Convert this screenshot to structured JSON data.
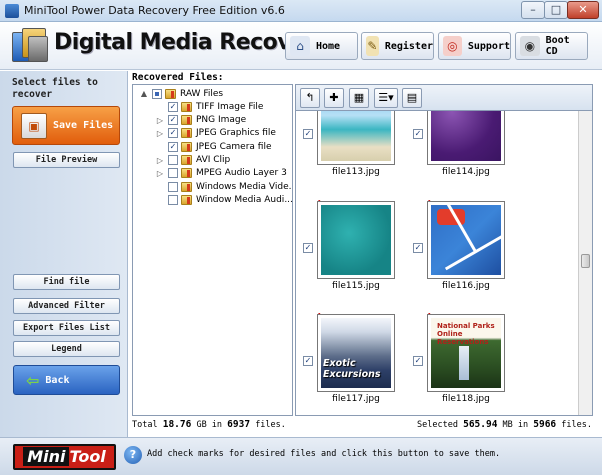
{
  "window": {
    "title": "MiniTool Power Data Recovery Free Edition v6.6",
    "minimize": "–",
    "maximize": "□",
    "close": "✕"
  },
  "header": {
    "brand": "Digital Media Recovery",
    "buttons": {
      "home": "Home",
      "register": "Register",
      "support": "Support",
      "boot_cd": "Boot CD"
    }
  },
  "left": {
    "select_label": "Select files to recover",
    "save_files": "Save Files",
    "file_preview": "File Preview",
    "find_file": "Find file",
    "advanced_filter": "Advanced Filter",
    "export_files_list": "Export Files List",
    "legend": "Legend",
    "back": "Back"
  },
  "recovered_label": "Recovered Files:",
  "tree": [
    {
      "label": "RAW Files",
      "expander": "▲",
      "check": "partial",
      "level": 0
    },
    {
      "label": "TIFF Image File",
      "expander": "",
      "check": "checked",
      "level": 1
    },
    {
      "label": "PNG Image",
      "expander": "▷",
      "check": "checked",
      "level": 1
    },
    {
      "label": "JPEG Graphics file",
      "expander": "▷",
      "check": "checked",
      "level": 1
    },
    {
      "label": "JPEG Camera file",
      "expander": "",
      "check": "checked",
      "level": 1
    },
    {
      "label": "AVI Clip",
      "expander": "▷",
      "check": "unchecked",
      "level": 1
    },
    {
      "label": "MPEG Audio Layer 3",
      "expander": "▷",
      "check": "unchecked",
      "level": 1
    },
    {
      "label": "Windows Media Vide...",
      "expander": "",
      "check": "unchecked",
      "level": 1
    },
    {
      "label": "Window Media Audi...",
      "expander": "",
      "check": "unchecked",
      "level": 1
    }
  ],
  "gallery": {
    "files": [
      {
        "name": "file113.jpg",
        "checked": true,
        "flag": false,
        "kind": "beach"
      },
      {
        "name": "file114.jpg",
        "checked": true,
        "flag": false,
        "kind": "purple"
      },
      {
        "name": "file115.jpg",
        "checked": true,
        "flag": true,
        "kind": "teal"
      },
      {
        "name": "file116.jpg",
        "checked": true,
        "flag": true,
        "kind": "court"
      },
      {
        "name": "file117.jpg",
        "checked": true,
        "flag": true,
        "kind": "lake",
        "caption": "Exotic Excursions"
      },
      {
        "name": "file118.jpg",
        "checked": true,
        "flag": true,
        "kind": "forest",
        "caption": "National Parks Online Reservations"
      }
    ]
  },
  "status": {
    "total_prefix": "Total",
    "total_size": "18.76",
    "total_unit": "GB in",
    "total_count": "6937",
    "total_suffix": "files.",
    "selected_prefix": "Selected",
    "selected_size": "565.94",
    "selected_unit": "MB in",
    "selected_count": "5966",
    "selected_suffix": "files."
  },
  "bottom": {
    "logo_mini": "Mini",
    "logo_tool": "Tool",
    "help": "?",
    "tip": "Add check marks for desired files and click this button to save them."
  }
}
